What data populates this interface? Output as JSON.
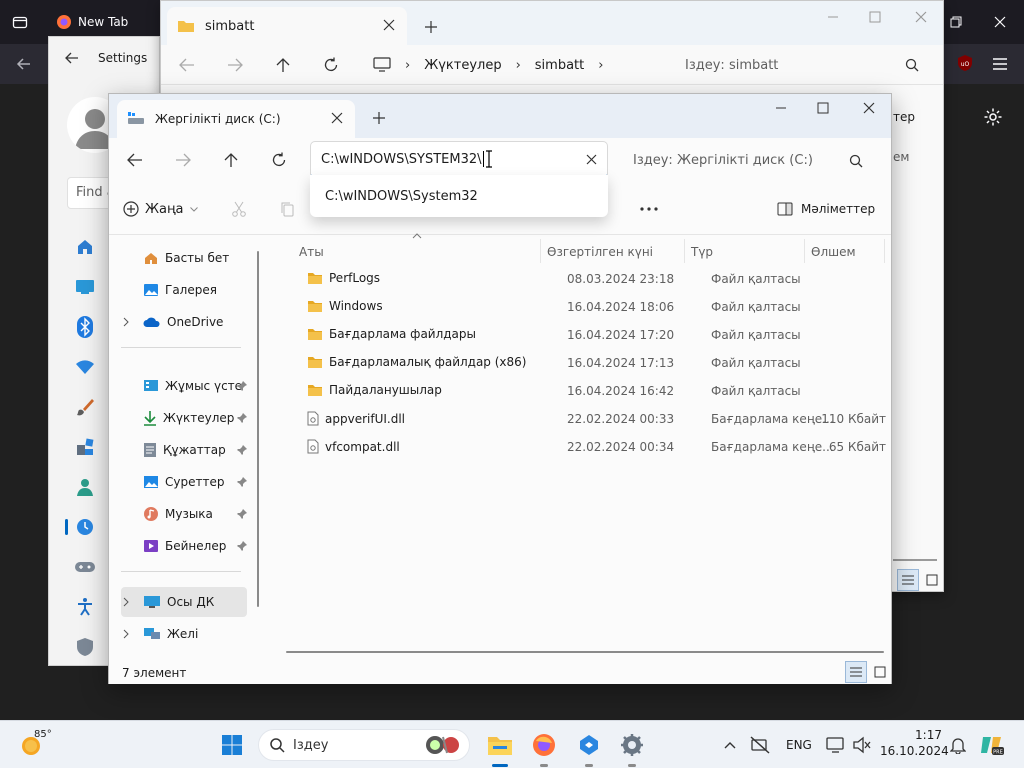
{
  "browser": {
    "tab_title": "New Tab"
  },
  "settings": {
    "title": "Settings",
    "find_placeholder": "Find a"
  },
  "explorer_bg": {
    "tab_title": "simbatt",
    "breadcrumb": [
      "Жүктеулер",
      "simbatt"
    ],
    "search_placeholder": "Іздеу: simbatt",
    "partial_ribbon_text": "тер",
    "partial_col_text": "ем"
  },
  "explorer": {
    "tab_title": "Жергілікті диск (C:)",
    "address_value": "C:\\wINDOWS\\SYSTEM32\\",
    "suggestion": "C:\\wINDOWS\\System32",
    "search_placeholder": "Іздеу: Жергілікті диск (C:)",
    "new_label": "Жаңа",
    "details_label": "Мәліметтер",
    "columns": {
      "name": "Аты",
      "modified": "Өзгертілген күні",
      "type": "Түр",
      "size": "Өлшем"
    },
    "sidebar": {
      "home": "Басты бет",
      "gallery": "Галерея",
      "onedrive": "OneDrive",
      "desktop": "Жұмыс үсте",
      "downloads": "Жүктеулер",
      "documents": "Құжаттар",
      "pictures": "Суреттер",
      "music": "Музыка",
      "videos": "Бейнелер",
      "thispc": "Осы ДК",
      "network": "Желі"
    },
    "files": [
      {
        "name": "PerfLogs",
        "date": "08.03.2024 23:18",
        "type": "Файл қалтасы",
        "size": "",
        "kind": "folder"
      },
      {
        "name": "Windows",
        "date": "16.04.2024 18:06",
        "type": "Файл қалтасы",
        "size": "",
        "kind": "folder"
      },
      {
        "name": "Бағдарлама файлдары",
        "date": "16.04.2024 17:20",
        "type": "Файл қалтасы",
        "size": "",
        "kind": "folder"
      },
      {
        "name": "Бағдарламалық файлдар (x86)",
        "date": "16.04.2024 17:13",
        "type": "Файл қалтасы",
        "size": "",
        "kind": "folder"
      },
      {
        "name": "Пайдаланушылар",
        "date": "16.04.2024 16:42",
        "type": "Файл қалтасы",
        "size": "",
        "kind": "folder"
      },
      {
        "name": "appverifUI.dll",
        "date": "22.02.2024 00:33",
        "type": "Бағдарлама кеңе...",
        "size": "110 Кбайт",
        "kind": "file"
      },
      {
        "name": "vfcompat.dll",
        "date": "22.02.2024 00:34",
        "type": "Бағдарлама кеңе...",
        "size": "65 Кбайт",
        "kind": "file"
      }
    ],
    "status": "7 элемент"
  },
  "taskbar": {
    "weather_temp": "85°",
    "search_placeholder": "Іздеу",
    "lang": "ENG",
    "time": "1:17",
    "date": "16.10.2024"
  },
  "colors": {
    "accent": "#0067c0",
    "folder": "#f4c14a"
  }
}
